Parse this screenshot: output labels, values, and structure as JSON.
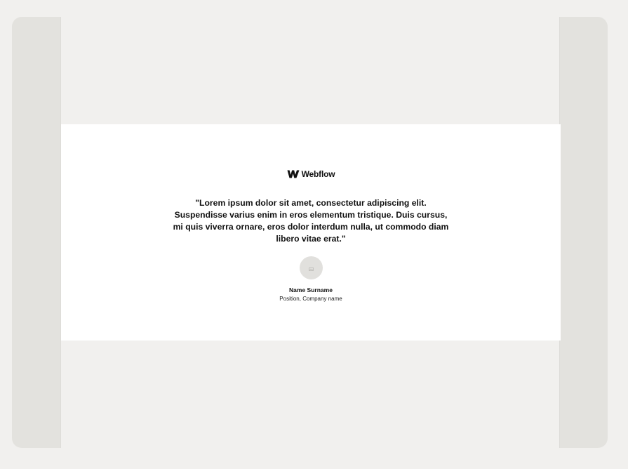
{
  "testimonial": {
    "logo": {
      "icon": "webflow-logo-icon",
      "text": "Webflow"
    },
    "quote": "\"Lorem ipsum dolor sit amet, consectetur adipiscing elit. Suspendisse varius enim in eros elementum tristique. Duis cursus, mi quis viverra ornare, eros dolor interdum nulla, ut commodo diam libero vitae erat.\"",
    "avatar": {
      "icon": "image-placeholder-icon"
    },
    "author": {
      "name": "Name Surname",
      "position": "Position, Company name"
    }
  },
  "colors": {
    "page_background": "#f1f0ee",
    "frame_background": "#e3e2de",
    "section_background": "#ffffff",
    "text": "#111111",
    "avatar_background": "#e1e0dd"
  }
}
